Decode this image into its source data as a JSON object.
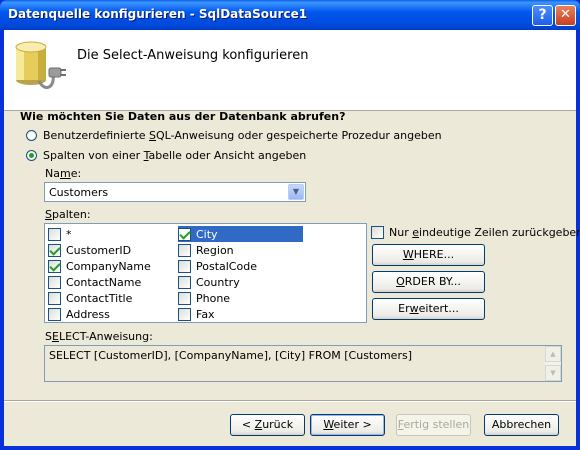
{
  "window": {
    "title": "Datenquelle konfigurieren - SqlDataSource1",
    "help_symbol": "?",
    "close_symbol": "✕"
  },
  "header": {
    "title": "Die Select-Anweisung konfigurieren",
    "icon": "database-connection-icon"
  },
  "question": "Wie möchten Sie Daten aus der Datenbank abrufen?",
  "options": {
    "custom_sql": {
      "before": "Benutzerdefinierte ",
      "key": "S",
      "after": "QL-Anweisung oder gespeicherte Prozedur angeben",
      "selected": false
    },
    "table_view": {
      "before": "Spalten von einer ",
      "key": "T",
      "after": "abelle oder Ansicht angeben",
      "selected": true
    }
  },
  "name_field": {
    "label_before": "Na",
    "label_key": "m",
    "label_after": "e:",
    "value": "Customers"
  },
  "columns_label": {
    "before": "",
    "key": "S",
    "after": "palten:"
  },
  "columns": {
    "left": [
      {
        "label": "*",
        "checked": false
      },
      {
        "label": "CustomerID",
        "checked": true
      },
      {
        "label": "CompanyName",
        "checked": true
      },
      {
        "label": "ContactName",
        "checked": false
      },
      {
        "label": "ContactTitle",
        "checked": false
      },
      {
        "label": "Address",
        "checked": false
      }
    ],
    "right": [
      {
        "label": "City",
        "checked": true,
        "highlighted": true
      },
      {
        "label": "Region",
        "checked": false
      },
      {
        "label": "PostalCode",
        "checked": false
      },
      {
        "label": "Country",
        "checked": false
      },
      {
        "label": "Phone",
        "checked": false
      },
      {
        "label": "Fax",
        "checked": false
      }
    ]
  },
  "unique_rows": {
    "before": "Nur ",
    "key": "e",
    "after": "indeutige Zeilen zurückgeben",
    "checked": false
  },
  "side_buttons": {
    "where": {
      "before": "",
      "key": "W",
      "after": "HERE..."
    },
    "order_by": {
      "before": "",
      "key": "O",
      "after": "RDER BY..."
    },
    "advanced": {
      "before": "Er",
      "key": "w",
      "after": "eitert..."
    }
  },
  "sql_label": {
    "before": "S",
    "key": "E",
    "after": "LECT-Anweisung:"
  },
  "sql_statement": "SELECT [CustomerID], [CompanyName], [City] FROM [Customers]",
  "footer": {
    "back": {
      "before": "< ",
      "key": "Z",
      "after": "urück"
    },
    "next": {
      "before": "",
      "key": "W",
      "after": "eiter >"
    },
    "finish": {
      "before": "",
      "key": "F",
      "after": "ertig stellen",
      "enabled": false
    },
    "cancel": {
      "label": "Abbrechen"
    }
  }
}
